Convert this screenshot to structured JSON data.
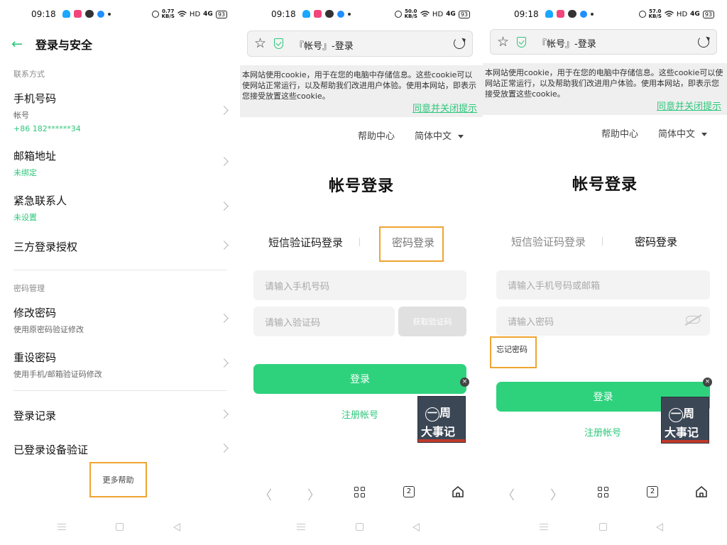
{
  "status": {
    "time": "09:18",
    "speeds": [
      "0.77",
      "50.0",
      "57.0"
    ],
    "speed_unit": "KB/S",
    "hd": "HD",
    "signal": "4G",
    "battery": "93"
  },
  "settings": {
    "title": "登录与安全",
    "section_contact": "联系方式",
    "phone": {
      "title": "手机号码",
      "sub": "帐号",
      "value": "+86 182******34"
    },
    "email": {
      "title": "邮箱地址",
      "value": "未绑定"
    },
    "emergency": {
      "title": "紧急联系人",
      "value": "未设置"
    },
    "thirdparty": {
      "title": "三方登录授权"
    },
    "section_password": "密码管理",
    "change_pwd": {
      "title": "修改密码",
      "sub": "使用原密码验证修改"
    },
    "reset_pwd": {
      "title": "重设密码",
      "sub": "使用手机/邮箱验证码修改"
    },
    "login_records": {
      "title": "登录记录"
    },
    "devices": {
      "title": "已登录设备验证"
    },
    "more_help": "更多帮助"
  },
  "browser": {
    "url_title": "『帐号』-登录",
    "cookie_text": "本网站使用cookie，用于在您的电脑中存储信息。这些cookie可以使网站正常运行，以及帮助我们改进用户体验。使用本网站，即表示您接受放置这些cookie。",
    "cookie_accept": "同意并关闭提示",
    "help_center": "帮助中心",
    "language": "简体中文",
    "login_title": "帐号登录",
    "tab_sms": "短信验证码登录",
    "tab_password": "密码登录",
    "register": "注册帐号",
    "login_button": "登录",
    "tabs_count": "2"
  },
  "sms_form": {
    "phone_placeholder": "请输入手机号码",
    "code_placeholder": "请输入验证码",
    "get_code": "获取验证码"
  },
  "password_form": {
    "account_placeholder": "请输入手机号码或邮箱",
    "password_placeholder": "请输入密码",
    "forgot": "忘记密码"
  },
  "promo": {
    "line1": [
      "一",
      "周"
    ],
    "line2": [
      "大",
      "事",
      "记"
    ],
    "close": "×"
  },
  "colors": {
    "accent": "#2ed27d",
    "highlight": "#f0a431"
  },
  "icons": [
    "back-arrow-icon",
    "star-icon",
    "shield-icon",
    "reload-icon",
    "eye-off-icon",
    "grid-icon",
    "tabs-icon",
    "home-icon"
  ]
}
